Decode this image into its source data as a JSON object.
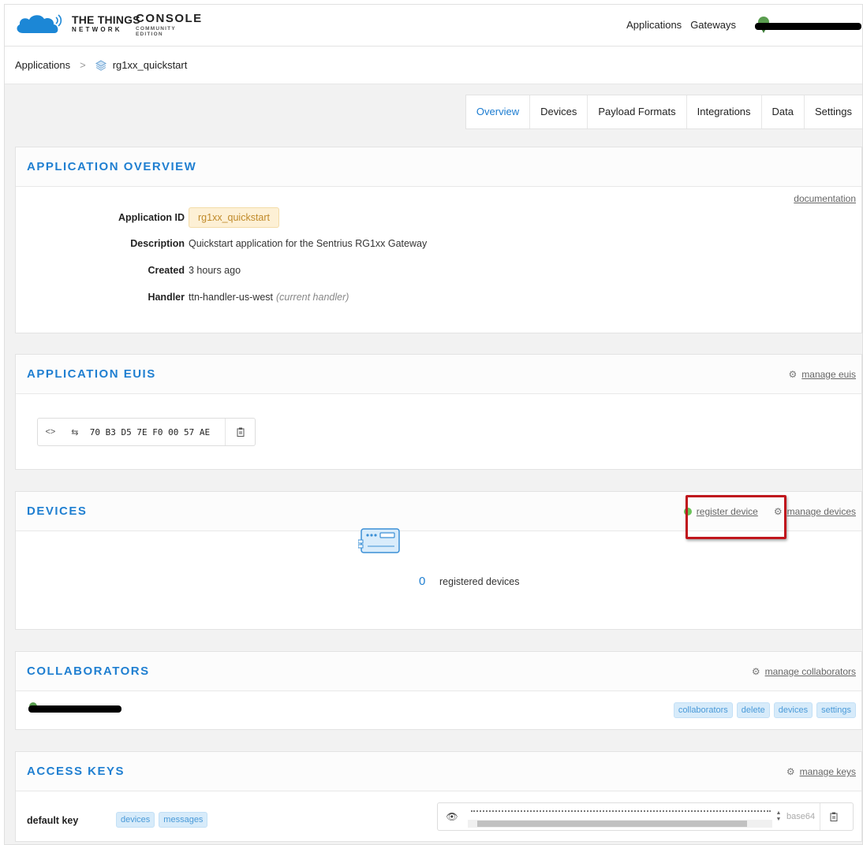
{
  "header": {
    "logo_line1": "THE THINGS",
    "logo_line2": "NETWORK",
    "console_big": "CONSOLE",
    "console_small": "COMMUNITY EDITION",
    "nav": [
      "Applications",
      "Gateways"
    ]
  },
  "breadcrumb": {
    "root": "Applications",
    "separator": ">",
    "current": "rg1xx_quickstart"
  },
  "tabs": [
    "Overview",
    "Devices",
    "Payload Formats",
    "Integrations",
    "Data",
    "Settings"
  ],
  "overview": {
    "title": "APPLICATION OVERVIEW",
    "documentation": "documentation",
    "fields": {
      "app_id_label": "Application ID",
      "app_id": "rg1xx_quickstart",
      "desc_label": "Description",
      "desc": "Quickstart application for the Sentrius RG1xx Gateway",
      "created_label": "Created",
      "created": "3 hours ago",
      "handler_label": "Handler",
      "handler": "ttn-handler-us-west",
      "handler_note": "(current handler)"
    }
  },
  "euis": {
    "title": "APPLICATION EUIS",
    "action": "manage euis",
    "value": "70 B3 D5 7E F0 00 57 AE",
    "toggle_glyph": "<>",
    "swap_glyph": "⇆"
  },
  "devices": {
    "title": "DEVICES",
    "register": "register device",
    "manage": "manage devices",
    "count": "0",
    "count_label": "registered devices"
  },
  "collaborators": {
    "title": "COLLABORATORS",
    "action": "manage collaborators",
    "rights": [
      "collaborators",
      "delete",
      "devices",
      "settings"
    ]
  },
  "access_keys": {
    "title": "ACCESS KEYS",
    "action": "manage keys",
    "key_name": "default key",
    "rights": [
      "devices",
      "messages"
    ],
    "encoding": "base64"
  },
  "colors": {
    "accent": "#1f7fd1",
    "highlight": "#c0161d",
    "badge_bg": "#fdf0d5",
    "tag_bg": "#d7ebfa"
  }
}
